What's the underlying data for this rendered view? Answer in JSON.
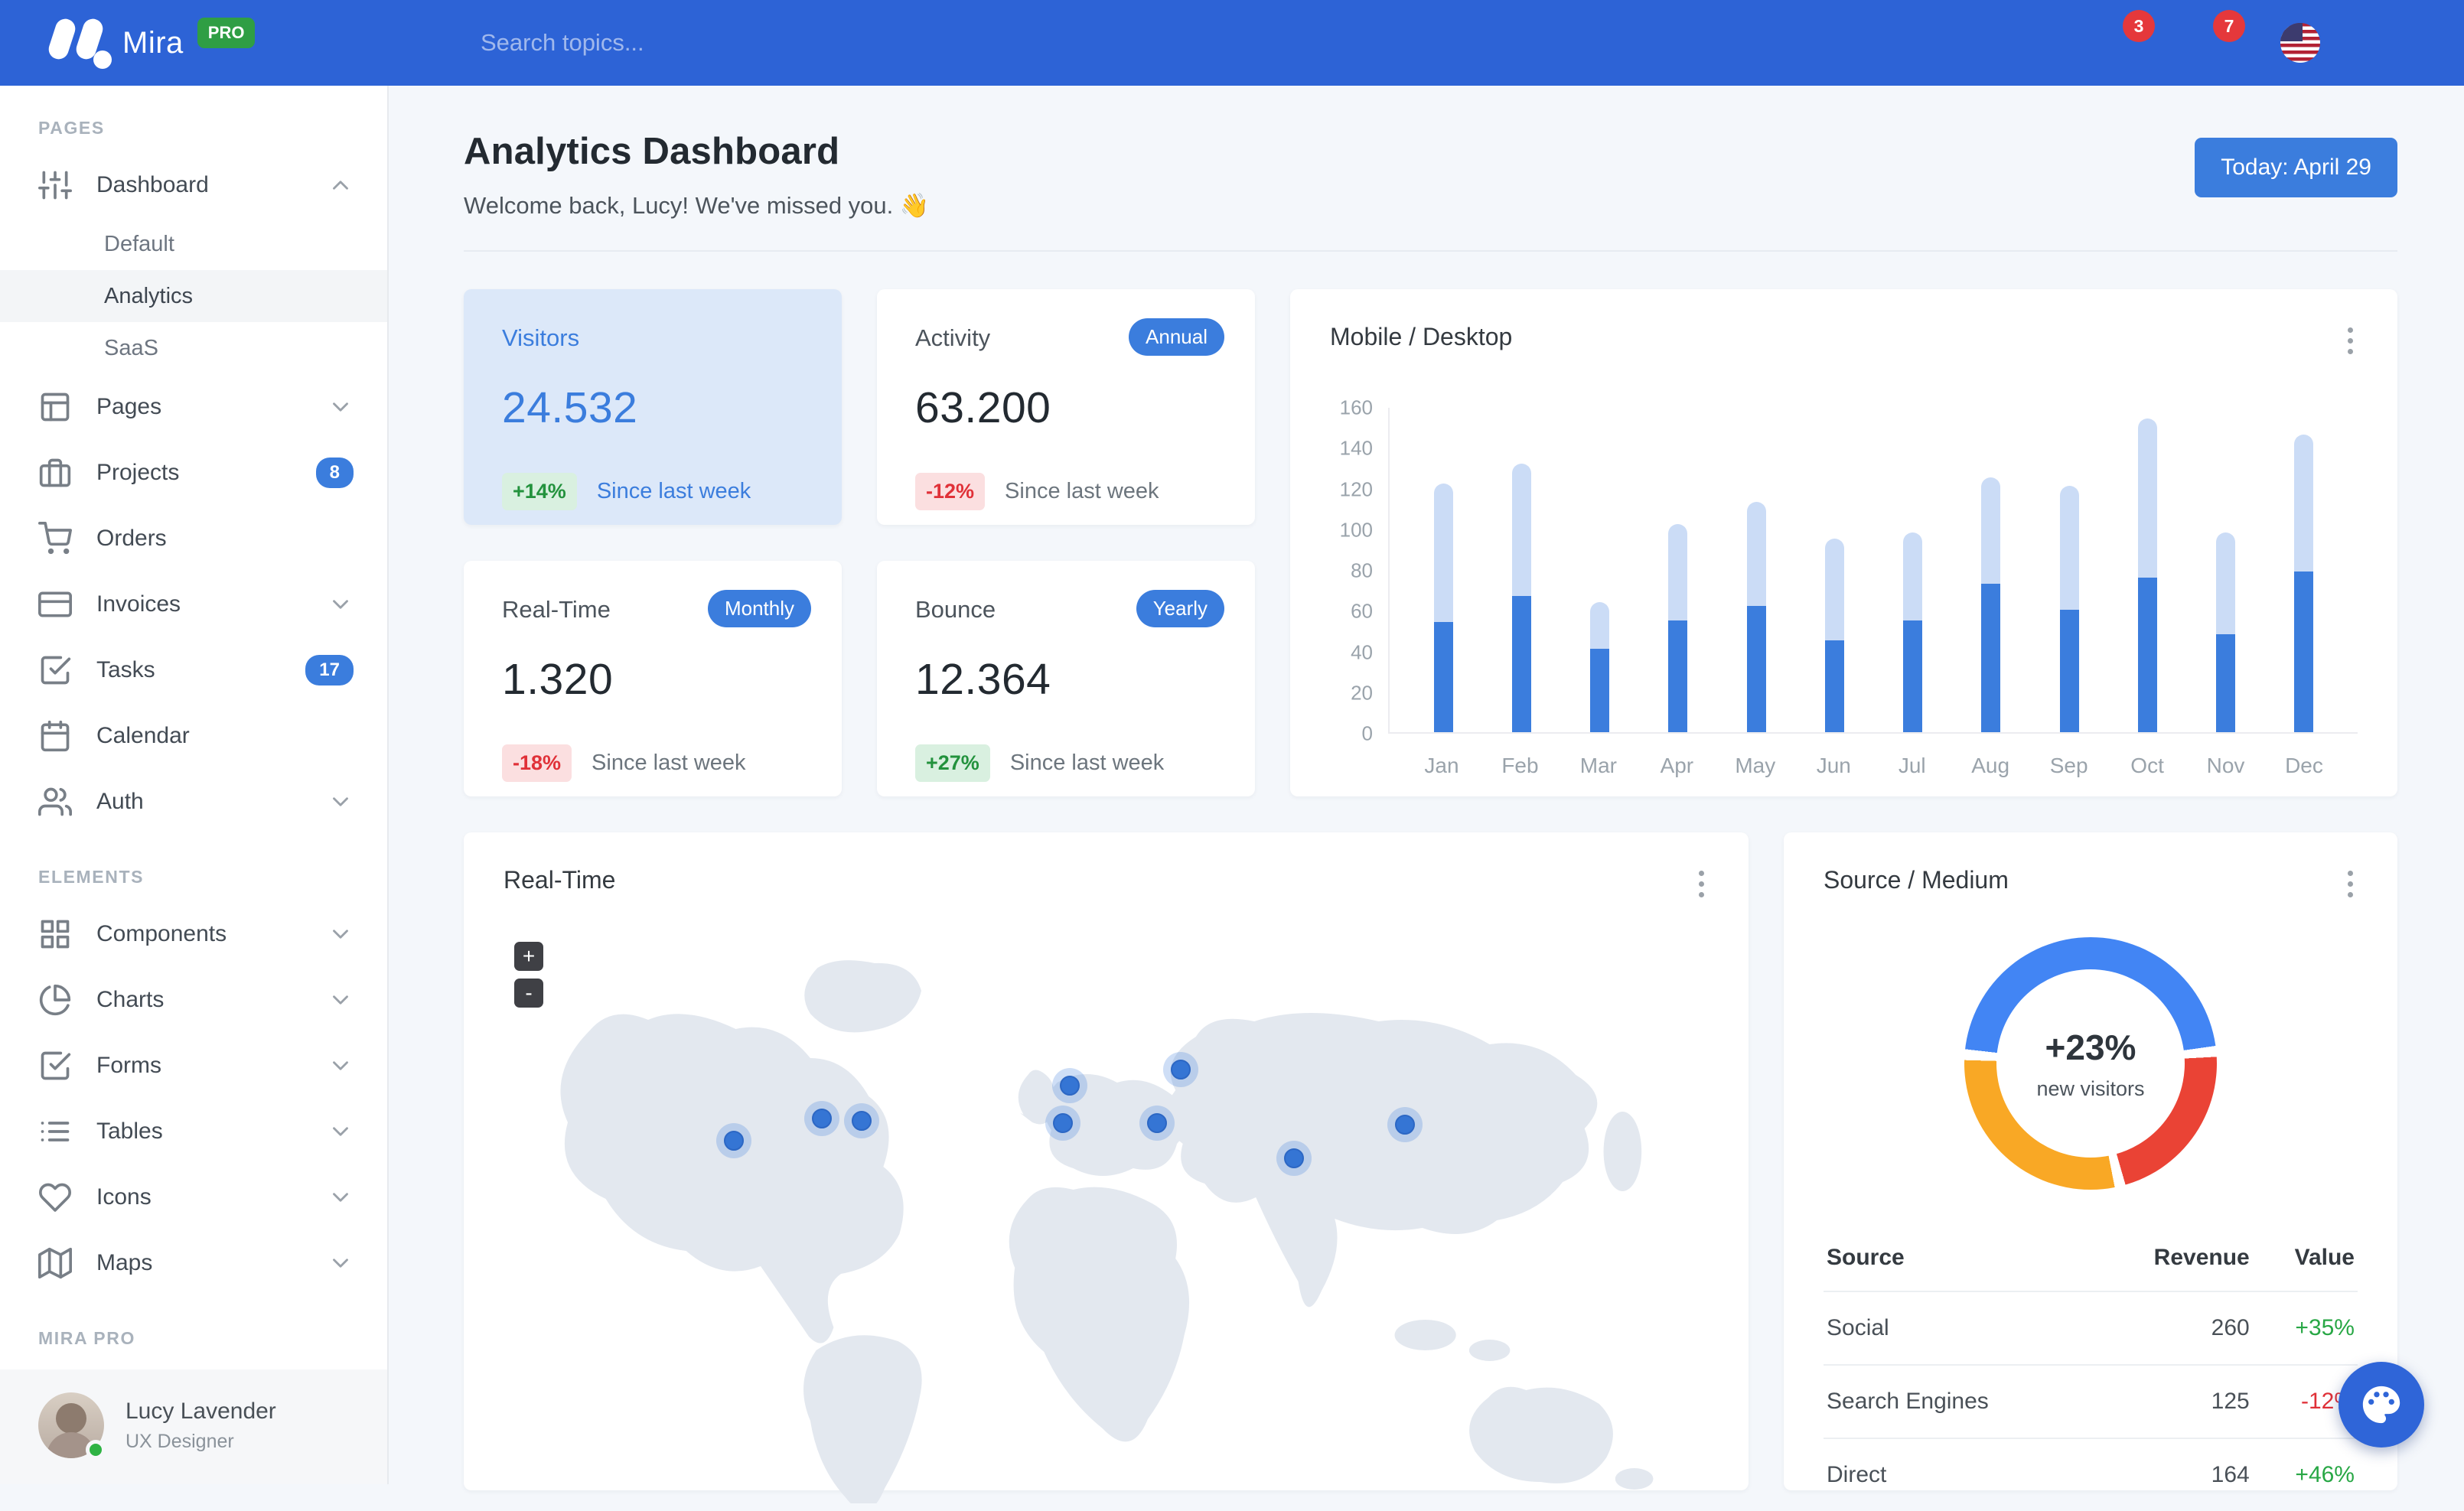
{
  "navbar": {
    "brand": "Mira",
    "brand_badge": "PRO",
    "search_placeholder": "Search topics...",
    "messages_badge": "3",
    "alerts_badge": "7"
  },
  "sidebar": {
    "sections": [
      {
        "label": "PAGES",
        "items": [
          {
            "label": "Dashboard",
            "icon": "sliders-icon",
            "chevron": "up",
            "children": [
              "Default",
              "Analytics",
              "SaaS"
            ],
            "active_child": "Analytics"
          },
          {
            "label": "Pages",
            "icon": "layout-icon",
            "chevron": "down"
          },
          {
            "label": "Projects",
            "icon": "briefcase-icon",
            "badge": "8"
          },
          {
            "label": "Orders",
            "icon": "cart-icon"
          },
          {
            "label": "Invoices",
            "icon": "credit-card-icon",
            "chevron": "down"
          },
          {
            "label": "Tasks",
            "icon": "check-square-icon",
            "badge": "17"
          },
          {
            "label": "Calendar",
            "icon": "calendar-icon"
          },
          {
            "label": "Auth",
            "icon": "users-icon",
            "chevron": "down"
          }
        ]
      },
      {
        "label": "ELEMENTS",
        "items": [
          {
            "label": "Components",
            "icon": "grid-icon",
            "chevron": "down"
          },
          {
            "label": "Charts",
            "icon": "pie-chart-icon",
            "chevron": "down"
          },
          {
            "label": "Forms",
            "icon": "check-square-icon",
            "chevron": "down"
          },
          {
            "label": "Tables",
            "icon": "list-icon",
            "chevron": "down"
          },
          {
            "label": "Icons",
            "icon": "heart-icon",
            "chevron": "down"
          },
          {
            "label": "Maps",
            "icon": "map-icon",
            "chevron": "down"
          }
        ]
      },
      {
        "label": "MIRA PRO",
        "items": []
      }
    ],
    "user": {
      "name": "Lucy Lavender",
      "role": "UX Designer"
    }
  },
  "header": {
    "title": "Analytics Dashboard",
    "welcome": "Welcome back, Lucy! We've missed you. 👋",
    "date_button": "Today: April 29"
  },
  "stats": [
    {
      "title": "Visitors",
      "value": "24.532",
      "badge": "",
      "delta": "+14%",
      "delta_type": "positive",
      "caption": "Since last week",
      "highlight": true
    },
    {
      "title": "Activity",
      "value": "63.200",
      "badge": "Annual",
      "delta": "-12%",
      "delta_type": "negative",
      "caption": "Since last week",
      "highlight": false
    },
    {
      "title": "Real-Time",
      "value": "1.320",
      "badge": "Monthly",
      "delta": "-18%",
      "delta_type": "negative",
      "caption": "Since last week",
      "highlight": false
    },
    {
      "title": "Bounce",
      "value": "12.364",
      "badge": "Yearly",
      "delta": "+27%",
      "delta_type": "positive",
      "caption": "Since last week",
      "highlight": false
    }
  ],
  "chart_data": [
    {
      "type": "bar",
      "stacked": true,
      "title": "Mobile / Desktop",
      "categories": [
        "Jan",
        "Feb",
        "Mar",
        "Apr",
        "May",
        "Jun",
        "Jul",
        "Aug",
        "Sep",
        "Oct",
        "Nov",
        "Dec"
      ],
      "series": [
        {
          "name": "Mobile",
          "color": "#3b7ddd",
          "values": [
            54,
            67,
            41,
            55,
            62,
            45,
            55,
            73,
            60,
            76,
            48,
            79
          ]
        },
        {
          "name": "Desktop",
          "color": "#cbdcf6",
          "values": [
            68,
            65,
            23,
            47,
            51,
            50,
            43,
            52,
            61,
            78,
            50,
            67
          ]
        }
      ],
      "ylim": [
        0,
        160
      ],
      "yticks": [
        0,
        20,
        40,
        60,
        80,
        100,
        120,
        140,
        160
      ],
      "grid": false,
      "legend": "none"
    },
    {
      "type": "pie",
      "title": "Source / Medium",
      "labels": [
        "Social",
        "Search Engines",
        "Direct"
      ],
      "values": [
        260,
        125,
        164
      ],
      "colors": [
        "#4285f4",
        "#ea4335",
        "#f9a825"
      ],
      "center_value": "+23%",
      "center_label": "new visitors"
    }
  ],
  "map_panel": {
    "title": "Real-Time",
    "zoom_in": "+",
    "zoom_out": "-",
    "markers": [
      {
        "x": 19.1,
        "y": 40.9
      },
      {
        "x": 26.4,
        "y": 36.7
      },
      {
        "x": 29.7,
        "y": 37.2
      },
      {
        "x": 47.0,
        "y": 30.5
      },
      {
        "x": 46.4,
        "y": 37.5
      },
      {
        "x": 56.2,
        "y": 27.6
      },
      {
        "x": 54.2,
        "y": 37.5
      },
      {
        "x": 65.6,
        "y": 44.1
      },
      {
        "x": 74.8,
        "y": 37.8
      }
    ]
  },
  "source_panel": {
    "title": "Source / Medium",
    "table": {
      "headers": [
        "Source",
        "Revenue",
        "Value"
      ],
      "rows": [
        {
          "source": "Social",
          "revenue": "260",
          "value": "+35%",
          "value_type": "positive"
        },
        {
          "source": "Search Engines",
          "revenue": "125",
          "value": "-12%",
          "value_type": "negative"
        },
        {
          "source": "Direct",
          "revenue": "164",
          "value": "+46%",
          "value_type": "positive"
        }
      ]
    }
  },
  "colors": {
    "navbar": "#2d63d6",
    "primary": "#3b7ddd",
    "success": "#28a745",
    "danger": "#e03138",
    "highlight_card": "#dce8f9",
    "map_land": "#e3e8ef"
  }
}
